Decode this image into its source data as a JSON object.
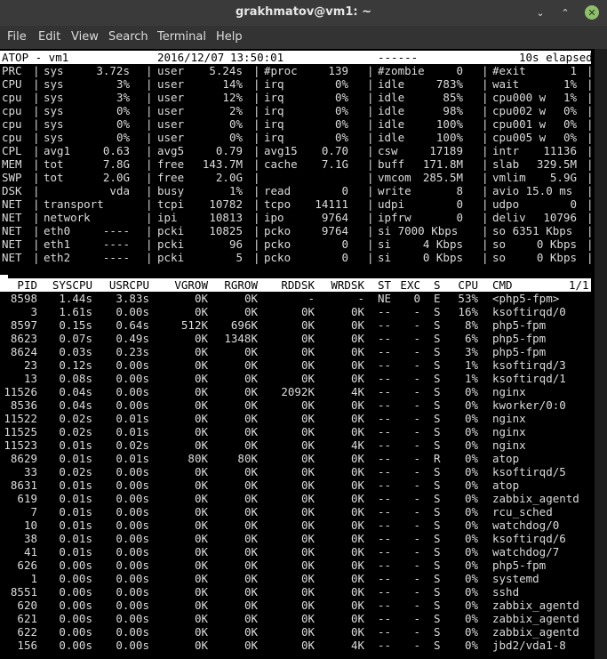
{
  "window": {
    "title": "grakhmatov@vm1: ~",
    "controls": [
      "minimize-icon",
      "maximize-icon",
      "close-icon"
    ]
  },
  "menu": [
    "File",
    "Edit",
    "View",
    "Search",
    "Terminal",
    "Help"
  ],
  "atop": {
    "header": {
      "left": "ATOP - vm1",
      "date": "2016/12/07",
      "time": "13:50:01",
      "dashes": "------",
      "elapsed": "10s elapsed"
    },
    "sys_rows": [
      [
        "PRC",
        "|",
        "sys",
        "3.72s",
        "|",
        "user",
        "5.24s",
        "|",
        "#proc",
        "139",
        "|",
        "#zombie",
        "0",
        "|",
        "#exit",
        "1",
        "|"
      ],
      [
        "CPU",
        "|",
        "sys",
        "3%",
        "|",
        "user",
        "14%",
        "|",
        "irq",
        "0%",
        "|",
        "idle",
        "783%",
        "|",
        "wait",
        "1%",
        "|"
      ],
      [
        "cpu",
        "|",
        "sys",
        "3%",
        "|",
        "user",
        "12%",
        "|",
        "irq",
        "0%",
        "|",
        "idle",
        "85%",
        "|",
        "cpu000 w",
        "1%",
        "|"
      ],
      [
        "cpu",
        "|",
        "sys",
        "0%",
        "|",
        "user",
        "2%",
        "|",
        "irq",
        "0%",
        "|",
        "idle",
        "98%",
        "|",
        "cpu002 w",
        "0%",
        "|"
      ],
      [
        "cpu",
        "|",
        "sys",
        "0%",
        "|",
        "user",
        "0%",
        "|",
        "irq",
        "0%",
        "|",
        "idle",
        "100%",
        "|",
        "cpu001 w",
        "0%",
        "|"
      ],
      [
        "cpu",
        "|",
        "sys",
        "0%",
        "|",
        "user",
        "0%",
        "|",
        "irq",
        "0%",
        "|",
        "idle",
        "100%",
        "|",
        "cpu005 w",
        "0%",
        "|"
      ],
      [
        "CPL",
        "|",
        "avg1",
        "0.63",
        "|",
        "avg5",
        "0.79",
        "|",
        "avg15",
        "0.70",
        "|",
        "csw",
        "17189",
        "|",
        "intr",
        "11136",
        "|"
      ],
      [
        "MEM",
        "|",
        "tot",
        "7.8G",
        "|",
        "free",
        "143.7M",
        "|",
        "cache",
        "7.1G",
        "|",
        "buff",
        "171.8M",
        "|",
        "slab",
        "329.5M",
        "|"
      ],
      [
        "SWP",
        "|",
        "tot",
        "2.0G",
        "|",
        "free",
        "2.0G",
        "|",
        "",
        "",
        "|",
        "vmcom",
        "285.5M",
        "|",
        "vmlim",
        "5.9G",
        "|"
      ],
      [
        "DSK",
        "|",
        "",
        "vda",
        "|",
        "busy",
        "1%",
        "|",
        "read",
        "0",
        "|",
        "write",
        "8",
        "|",
        "avio 15.0 ms",
        "",
        "|"
      ],
      [
        "NET",
        "|",
        "transport",
        "",
        "|",
        "tcpi",
        "10782",
        "|",
        "tcpo",
        "14111",
        "|",
        "udpi",
        "0",
        "|",
        "udpo",
        "0",
        "|"
      ],
      [
        "NET",
        "|",
        "network",
        "",
        "|",
        "ipi",
        "10813",
        "|",
        "ipo",
        "9764",
        "|",
        "ipfrw",
        "0",
        "|",
        "deliv",
        "10796",
        "|"
      ],
      [
        "NET",
        "|",
        "eth0",
        "----",
        "|",
        "pcki",
        "10825",
        "|",
        "pcko",
        "9764",
        "|",
        "si 7000 Kbps",
        "",
        "|",
        "so 6351 Kbps",
        "",
        "|"
      ],
      [
        "NET",
        "|",
        "eth1",
        "----",
        "|",
        "pcki",
        "96",
        "|",
        "pcko",
        "0",
        "|",
        "si",
        "4 Kbps",
        "|",
        "so",
        "0 Kbps",
        "|"
      ],
      [
        "NET",
        "|",
        "eth2",
        "----",
        "|",
        "pcki",
        "5",
        "|",
        "pcko",
        "0",
        "|",
        "si",
        "0 Kbps",
        "|",
        "so",
        "0 Kbps",
        "|"
      ]
    ],
    "proc_columns": [
      "PID",
      "SYSCPU",
      "USRCPU",
      "VGROW",
      "RGROW",
      "RDDSK",
      "WRDSK",
      "ST",
      "EXC",
      "S",
      "CPU",
      "CMD",
      "1/1"
    ],
    "processes": [
      [
        "8598",
        "1.44s",
        "3.83s",
        "0K",
        "0K",
        "-",
        "-",
        "NE",
        "0",
        "E",
        "53%",
        "<php5-fpm>"
      ],
      [
        "3",
        "1.61s",
        "0.00s",
        "0K",
        "0K",
        "0K",
        "0K",
        "--",
        "-",
        "S",
        "16%",
        "ksoftirqd/0"
      ],
      [
        "8597",
        "0.15s",
        "0.64s",
        "512K",
        "696K",
        "0K",
        "0K",
        "--",
        "-",
        "S",
        "8%",
        "php5-fpm"
      ],
      [
        "8623",
        "0.07s",
        "0.49s",
        "0K",
        "1348K",
        "0K",
        "0K",
        "--",
        "-",
        "S",
        "6%",
        "php5-fpm"
      ],
      [
        "8624",
        "0.03s",
        "0.23s",
        "0K",
        "0K",
        "0K",
        "0K",
        "--",
        "-",
        "S",
        "3%",
        "php5-fpm"
      ],
      [
        "23",
        "0.12s",
        "0.00s",
        "0K",
        "0K",
        "0K",
        "0K",
        "--",
        "-",
        "S",
        "1%",
        "ksoftirqd/3"
      ],
      [
        "13",
        "0.08s",
        "0.00s",
        "0K",
        "0K",
        "0K",
        "0K",
        "--",
        "-",
        "S",
        "1%",
        "ksoftirqd/1"
      ],
      [
        "11526",
        "0.04s",
        "0.00s",
        "0K",
        "0K",
        "2092K",
        "4K",
        "--",
        "-",
        "S",
        "0%",
        "nginx"
      ],
      [
        "8536",
        "0.04s",
        "0.00s",
        "0K",
        "0K",
        "0K",
        "0K",
        "--",
        "-",
        "S",
        "0%",
        "kworker/0:0"
      ],
      [
        "11522",
        "0.02s",
        "0.01s",
        "0K",
        "0K",
        "0K",
        "0K",
        "--",
        "-",
        "S",
        "0%",
        "nginx"
      ],
      [
        "11525",
        "0.02s",
        "0.01s",
        "0K",
        "0K",
        "0K",
        "0K",
        "--",
        "-",
        "S",
        "0%",
        "nginx"
      ],
      [
        "11523",
        "0.01s",
        "0.02s",
        "0K",
        "0K",
        "0K",
        "4K",
        "--",
        "-",
        "S",
        "0%",
        "nginx"
      ],
      [
        "8629",
        "0.01s",
        "0.01s",
        "80K",
        "80K",
        "0K",
        "0K",
        "--",
        "-",
        "R",
        "0%",
        "atop"
      ],
      [
        "33",
        "0.02s",
        "0.00s",
        "0K",
        "0K",
        "0K",
        "0K",
        "--",
        "-",
        "S",
        "0%",
        "ksoftirqd/5"
      ],
      [
        "8631",
        "0.01s",
        "0.00s",
        "0K",
        "0K",
        "0K",
        "0K",
        "--",
        "-",
        "S",
        "0%",
        "atop"
      ],
      [
        "619",
        "0.01s",
        "0.00s",
        "0K",
        "0K",
        "0K",
        "0K",
        "--",
        "-",
        "S",
        "0%",
        "zabbix_agentd"
      ],
      [
        "7",
        "0.01s",
        "0.00s",
        "0K",
        "0K",
        "0K",
        "0K",
        "--",
        "-",
        "S",
        "0%",
        "rcu_sched"
      ],
      [
        "10",
        "0.01s",
        "0.00s",
        "0K",
        "0K",
        "0K",
        "0K",
        "--",
        "-",
        "S",
        "0%",
        "watchdog/0"
      ],
      [
        "38",
        "0.01s",
        "0.00s",
        "0K",
        "0K",
        "0K",
        "0K",
        "--",
        "-",
        "S",
        "0%",
        "ksoftirqd/6"
      ],
      [
        "41",
        "0.01s",
        "0.00s",
        "0K",
        "0K",
        "0K",
        "0K",
        "--",
        "-",
        "S",
        "0%",
        "watchdog/7"
      ],
      [
        "626",
        "0.00s",
        "0.00s",
        "0K",
        "0K",
        "0K",
        "0K",
        "--",
        "-",
        "S",
        "0%",
        "php5-fpm"
      ],
      [
        "1",
        "0.00s",
        "0.00s",
        "0K",
        "0K",
        "0K",
        "0K",
        "--",
        "-",
        "S",
        "0%",
        "systemd"
      ],
      [
        "8551",
        "0.00s",
        "0.00s",
        "0K",
        "0K",
        "0K",
        "0K",
        "--",
        "-",
        "S",
        "0%",
        "sshd"
      ],
      [
        "620",
        "0.00s",
        "0.00s",
        "0K",
        "0K",
        "0K",
        "0K",
        "--",
        "-",
        "S",
        "0%",
        "zabbix_agentd"
      ],
      [
        "621",
        "0.00s",
        "0.00s",
        "0K",
        "0K",
        "0K",
        "0K",
        "--",
        "-",
        "S",
        "0%",
        "zabbix_agentd"
      ],
      [
        "622",
        "0.00s",
        "0.00s",
        "0K",
        "0K",
        "0K",
        "0K",
        "--",
        "-",
        "S",
        "0%",
        "zabbix_agentd"
      ],
      [
        "156",
        "0.00s",
        "0.00s",
        "0K",
        "0K",
        "0K",
        "4K",
        "--",
        "-",
        "S",
        "0%",
        "jbd2/vda1-8"
      ]
    ]
  }
}
